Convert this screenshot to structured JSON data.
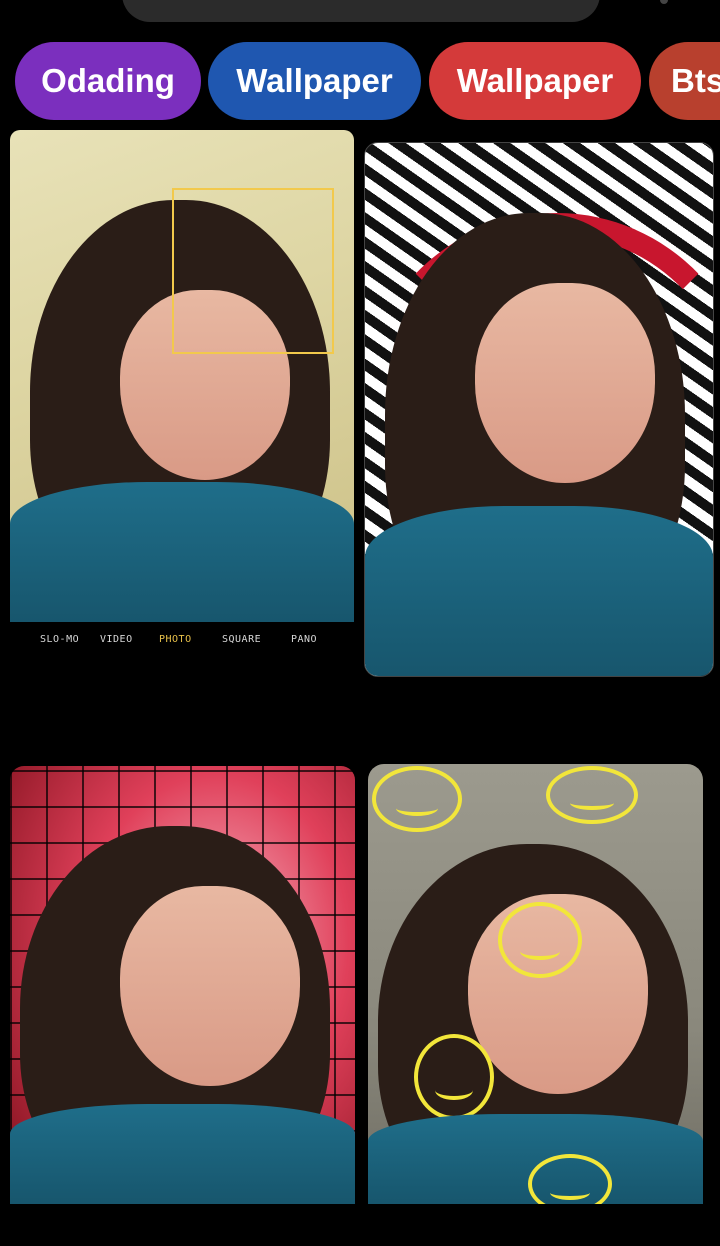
{
  "chips": [
    {
      "label": "Odading",
      "color": "#7b2fbe"
    },
    {
      "label": "Wallpaper",
      "color": "#1f57b0"
    },
    {
      "label": "Wallpaper",
      "color": "#d43a3a"
    },
    {
      "label": "Bts",
      "color": "#b8402e"
    }
  ],
  "camera_modes": [
    "SLO-MO",
    "VIDEO",
    "PHOTO",
    "SQUARE",
    "PANO"
  ],
  "active_mode": "PHOTO"
}
